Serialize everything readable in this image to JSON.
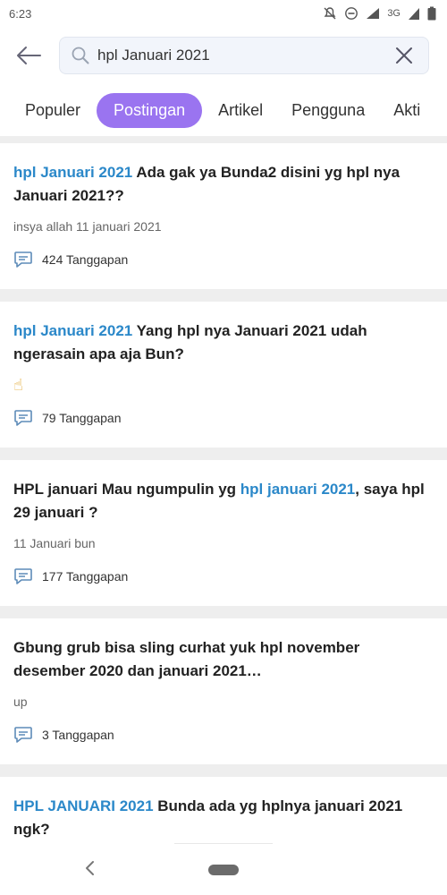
{
  "status_bar": {
    "time": "6:23",
    "network": "3G"
  },
  "search": {
    "value": "hpl Januari 2021",
    "placeholder": ""
  },
  "tabs": [
    {
      "label": "Populer",
      "active": false
    },
    {
      "label": "Postingan",
      "active": true
    },
    {
      "label": "Artikel",
      "active": false
    },
    {
      "label": "Pengguna",
      "active": false
    },
    {
      "label": "Akti",
      "active": false
    }
  ],
  "posts": [
    {
      "highlight": "hpl Januari 2021",
      "title": " Ada gak ya Bunda2 disini yg hpl nya Januari 2021??",
      "snippet": "insya allah 11 januari 2021",
      "replies": "424 Tanggapan"
    },
    {
      "highlight": "hpl Januari 2021",
      "title": " Yang hpl nya Januari 2021 udah ngerasain apa aja Bun?",
      "snippet": "☝",
      "replies": "79 Tanggapan"
    },
    {
      "title_before": "HPL januari Mau ngumpulin yg ",
      "highlight": "hpl januari 2021",
      "title_after": ", saya hpl 29 januari ?",
      "snippet": "11 Januari bun",
      "replies": "177 Tanggapan"
    },
    {
      "title": "Gbung grub bisa sling curhat yuk hpl november desember 2020 dan januari 2021…",
      "snippet": "up",
      "replies": "3 Tanggapan"
    },
    {
      "highlight": "HPL JANUARI 2021",
      "title": " Bunda ada yg hplnya januari 2021 ngk?"
    }
  ],
  "colors": {
    "accent": "#9a74f0",
    "highlight": "#2b88c9",
    "divider": "#eeeeee"
  },
  "icons": {
    "back": "arrow-left-icon",
    "search": "search-icon",
    "clear": "close-icon",
    "comment": "comment-icon",
    "nav_back": "chevron-left-icon"
  }
}
